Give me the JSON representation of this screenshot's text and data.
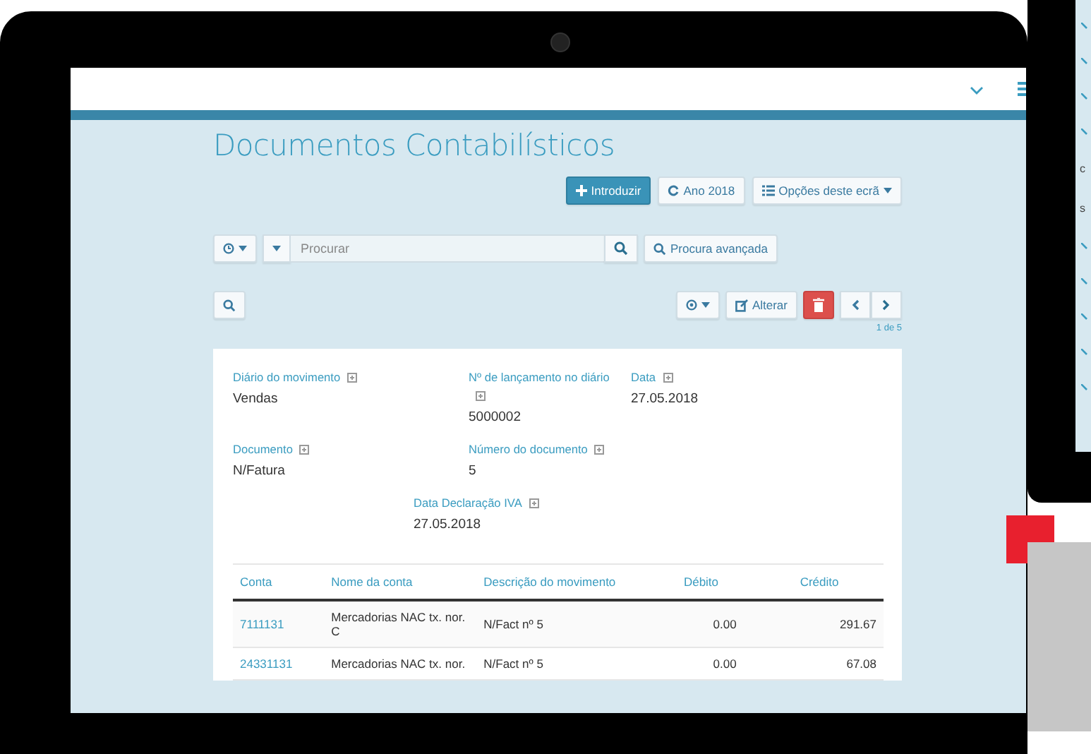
{
  "page": {
    "title": "Documentos Contabilísticos"
  },
  "actions": [
    {
      "kind": "primary",
      "label": "Introduzir"
    },
    {
      "kind": "default",
      "label": "Ano 2018"
    },
    {
      "kind": "dropdown",
      "label": "Opções deste ecrã"
    }
  ],
  "search": {
    "placeholder": "Procurar",
    "advanced_label": "Procura avançada"
  },
  "record_toolbar": {
    "edit_label": "Alterar",
    "pagination": "1 de 5"
  },
  "fields": [
    {
      "label": "Diário do movimento",
      "value": "Vendas"
    },
    {
      "label": "Nº de lançamento no diário",
      "value": "5000002"
    },
    {
      "label": "Data",
      "value": "27.05.2018"
    },
    {
      "label": "Documento",
      "value": "N/Fatura"
    },
    {
      "label": "Número do documento",
      "value": "5"
    },
    {
      "label": "Data Declaração IVA",
      "value": "27.05.2018"
    }
  ],
  "table": {
    "columns": [
      "Conta",
      "Nome da conta",
      "Descrição do movimento",
      "Débito",
      "Crédito"
    ],
    "rows": [
      {
        "conta": "7111131",
        "nome": "Mercadorias NAC tx. nor. C",
        "descricao": "N/Fact nº 5",
        "debito": "0.00",
        "credito": "291.67"
      },
      {
        "conta": "24331131",
        "nome": "Mercadorias NAC tx. nor.",
        "descricao": "N/Fact nº 5",
        "debito": "0.00",
        "credito": "67.08"
      }
    ]
  },
  "side_panel": {
    "fragments": [
      "c",
      "s"
    ]
  }
}
